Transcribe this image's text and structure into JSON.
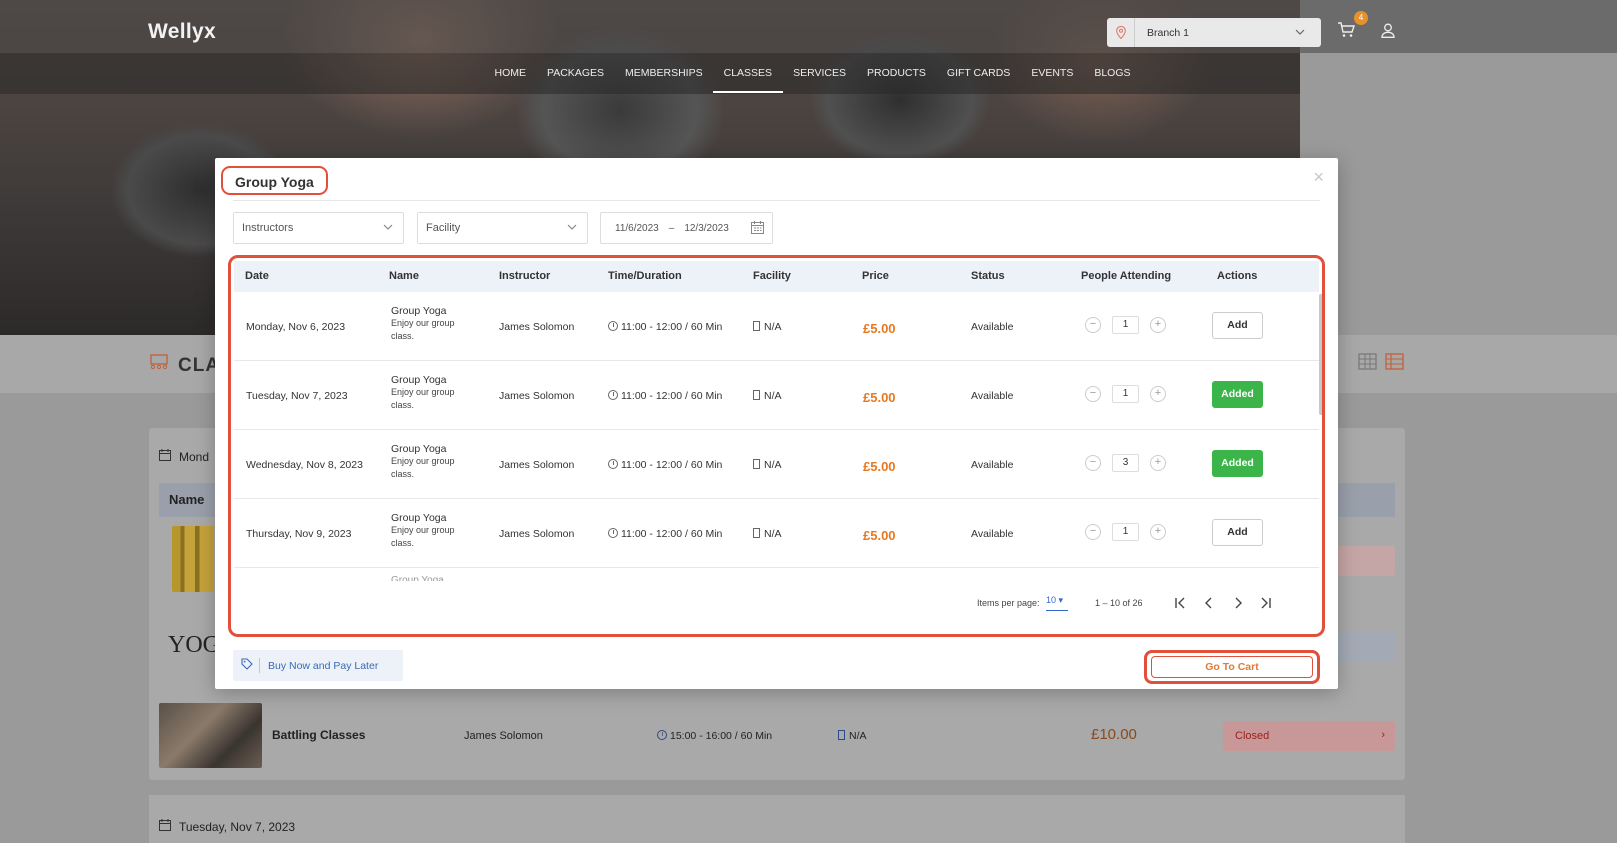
{
  "app": {
    "logo": "Wellyx",
    "branch": "Branch 1",
    "cart_count": "4"
  },
  "nav": [
    "HOME",
    "PACKAGES",
    "MEMBERSHIPS",
    "CLASSES",
    "SERVICES",
    "PRODUCTS",
    "GIFT CARDS",
    "EVENTS",
    "BLOGS"
  ],
  "nav_active": "CLASSES",
  "background": {
    "section_title": "CLA",
    "day1": "Mond",
    "name_header": "Name",
    "row_name": "Battling Classes",
    "row_instructor": "James Solomon",
    "row_time": "15:00 - 16:00 / 60 Min",
    "row_facility": "N/A",
    "row_price": "£10.00",
    "row_status": "Closed",
    "yoga_logo": "YOG",
    "day2": "Tuesday, Nov 7, 2023"
  },
  "modal": {
    "title": "Group Yoga",
    "filters": {
      "instructors": "Instructors",
      "facility": "Facility",
      "date_from": "11/6/2023",
      "date_sep": "–",
      "date_to": "12/3/2023"
    },
    "columns": [
      "Date",
      "Name",
      "Instructor",
      "Time/Duration",
      "Facility",
      "Price",
      "Status",
      "People Attending",
      "Actions"
    ],
    "rows": [
      {
        "date": "Monday, Nov 6, 2023",
        "name": "Group Yoga",
        "desc": "Enjoy our group class.",
        "instructor": "James Solomon",
        "time": "11:00 - 12:00 / 60 Min",
        "facility": "N/A",
        "price": "£5.00",
        "status": "Available",
        "qty": "1",
        "action": "Add",
        "added": false
      },
      {
        "date": "Tuesday, Nov 7, 2023",
        "name": "Group Yoga",
        "desc": "Enjoy our group class.",
        "instructor": "James Solomon",
        "time": "11:00 - 12:00 / 60 Min",
        "facility": "N/A",
        "price": "£5.00",
        "status": "Available",
        "qty": "1",
        "action": "Added",
        "added": true
      },
      {
        "date": "Wednesday, Nov 8, 2023",
        "name": "Group Yoga",
        "desc": "Enjoy our group class.",
        "instructor": "James Solomon",
        "time": "11:00 - 12:00 / 60 Min",
        "facility": "N/A",
        "price": "£5.00",
        "status": "Available",
        "qty": "3",
        "action": "Added",
        "added": true
      },
      {
        "date": "Thursday, Nov 9, 2023",
        "name": "Group Yoga",
        "desc": "Enjoy our group class.",
        "instructor": "James Solomon",
        "time": "11:00 - 12:00 / 60 Min",
        "facility": "N/A",
        "price": "£5.00",
        "status": "Available",
        "qty": "1",
        "action": "Add",
        "added": false
      }
    ],
    "partial_row": "Group Yoga",
    "pagination": {
      "items_per_page_label": "Items per page:",
      "items_per_page": "10",
      "range": "1 – 10 of 26"
    },
    "buy_now_pay_later": "Buy Now and Pay Later",
    "go_to_cart": "Go To Cart"
  },
  "colors": {
    "accent_orange": "#e8781f",
    "highlight_red": "#e0503a",
    "added_green": "#3bb54a",
    "link_blue": "#3a6ab8"
  }
}
